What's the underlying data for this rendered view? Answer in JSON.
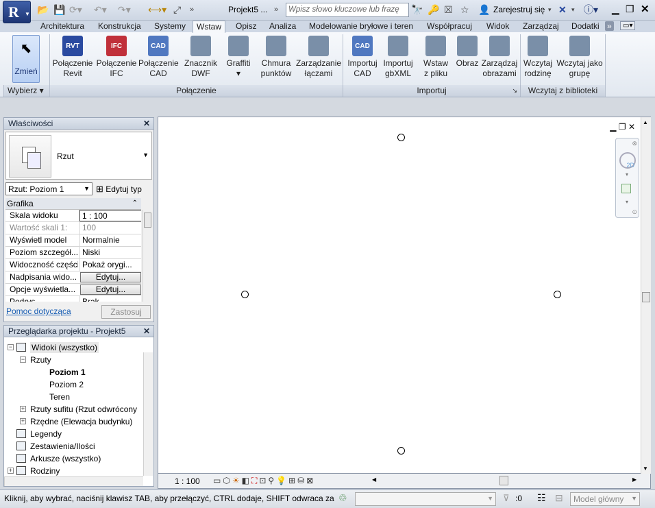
{
  "titlebar": {
    "document_title": "Projekt5 ...",
    "search_placeholder": "Wpisz słowo kluczowe lub frazę",
    "sign_in": "Zarejestruj się"
  },
  "tabs": [
    "Architektura",
    "Konstrukcja",
    "Systemy",
    "Wstaw",
    "Opisz",
    "Analiza",
    "Modelowanie bryłowe i teren",
    "Współpracuj",
    "Widok",
    "Zarządzaj",
    "Dodatki"
  ],
  "active_tab": "Wstaw",
  "ribbon": {
    "select": {
      "label": "Zmień",
      "panel": "Wybierz"
    },
    "link_buttons": [
      {
        "l1": "Połączenie",
        "l2": "Revit",
        "icon": "RVT"
      },
      {
        "l1": "Połączenie",
        "l2": "IFC",
        "icon": "IFC"
      },
      {
        "l1": "Połączenie",
        "l2": "CAD",
        "icon": "CAD"
      },
      {
        "l1": "Znacznik",
        "l2": "DWF",
        "icon": ""
      },
      {
        "l1": "Graffiti",
        "l2": "▾",
        "icon": ""
      },
      {
        "l1": "Chmura",
        "l2": "punktów",
        "icon": ""
      },
      {
        "l1": "Zarządzanie",
        "l2": "łączami",
        "icon": ""
      }
    ],
    "link_panel": "Połączenie",
    "import_buttons": [
      {
        "l1": "Importuj",
        "l2": "CAD",
        "icon": "CAD"
      },
      {
        "l1": "Importuj",
        "l2": "gbXML",
        "icon": ""
      },
      {
        "l1": "Wstaw",
        "l2": "z pliku",
        "icon": ""
      },
      {
        "l1": "Obraz",
        "l2": "",
        "icon": ""
      },
      {
        "l1": "Zarządzaj",
        "l2": "obrazami",
        "icon": ""
      }
    ],
    "import_panel": "Importuj",
    "library_buttons": [
      {
        "l1": "Wczytaj",
        "l2": "rodzinę",
        "icon": ""
      },
      {
        "l1": "Wczytaj jako",
        "l2": "grupę",
        "icon": ""
      }
    ],
    "library_panel": "Wczytaj z biblioteki"
  },
  "properties": {
    "title": "Właściwości",
    "type_name": "Rzut",
    "selector": "Rzut: Poziom 1",
    "edit_type": "Edytuj typ",
    "group": "Grafika",
    "rows": [
      {
        "k": "Skala widoku",
        "v": "1 : 100"
      },
      {
        "k": "Wartość skali   1:",
        "v": "100"
      },
      {
        "k": "Wyświetl model",
        "v": "Normalnie"
      },
      {
        "k": "Poziom szczegół...",
        "v": "Niski"
      },
      {
        "k": "Widoczność części",
        "v": "Pokaż orygi..."
      },
      {
        "k": "Nadpisania wido...",
        "v": "Edytuj..."
      },
      {
        "k": "Opcje wyświetla...",
        "v": "Edytuj..."
      },
      {
        "k": "Podrys",
        "v": "Brak"
      }
    ],
    "help_link": "Pomoc dotycząca",
    "apply": "Zastosuj"
  },
  "browser": {
    "title": "Przeglądarka projektu - Projekt5",
    "nodes": [
      {
        "label": "Widoki (wszystko)",
        "level": 0,
        "exp": "⊟",
        "icon": "views"
      },
      {
        "label": "Rzuty",
        "level": 1,
        "exp": "⊟"
      },
      {
        "label": "Poziom 1",
        "level": 2,
        "bold": true
      },
      {
        "label": "Poziom 2",
        "level": 2
      },
      {
        "label": "Teren",
        "level": 2
      },
      {
        "label": "Rzuty sufitu (Rzut odwrócony",
        "level": 1,
        "exp": "⊞"
      },
      {
        "label": "Rzędne (Elewacja budynku)",
        "level": 1,
        "exp": "⊞"
      },
      {
        "label": "Legendy",
        "level": 0,
        "icon": "legend"
      },
      {
        "label": "Zestawienia/Ilości",
        "level": 0,
        "icon": "schedule"
      },
      {
        "label": "Arkusze (wszystko)",
        "level": 0,
        "icon": "sheet"
      },
      {
        "label": "Rodziny",
        "level": 0,
        "exp": "⊞",
        "icon": "family"
      }
    ]
  },
  "viewbar": {
    "scale": "1 : 100"
  },
  "status": {
    "message": "Kliknij, aby wybrać, naciśnij klawisz TAB, aby przełączyć, CTRL dodaje, SHIFT odwraca zazna",
    "filter_count": ":0",
    "model": "Model główny"
  },
  "colors": {
    "accent": "#1d3574",
    "ribbon_bg": "#eef2f7"
  }
}
